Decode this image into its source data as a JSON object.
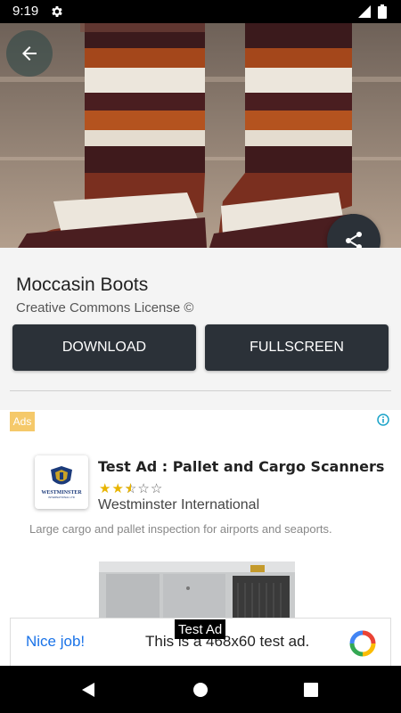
{
  "status_bar": {
    "time": "9:19"
  },
  "detail": {
    "title": "Moccasin Boots",
    "license": "Creative Commons License ©",
    "download_label": "DOWNLOAD",
    "fullscreen_label": "FULLSCREEN"
  },
  "native_ad": {
    "badge": "Ads",
    "headline": "Test Ad : Pallet and Cargo Scanners",
    "rating": 2.5,
    "advertiser": "Westminster International",
    "body": "Large cargo and pallet inspection for airports and seaports.",
    "logo_name": "WESTMINSTER",
    "logo_sub": "INTERNATIONAL LTD"
  },
  "banner_ad": {
    "label": "Test Ad",
    "title": "Nice job!",
    "text": "This is a 468x60 test ad."
  },
  "colors": {
    "accent_dark": "#2b3138",
    "ad_badge": "#f5c96a",
    "banner_title": "#1a73e8",
    "star": "#e8b400"
  }
}
